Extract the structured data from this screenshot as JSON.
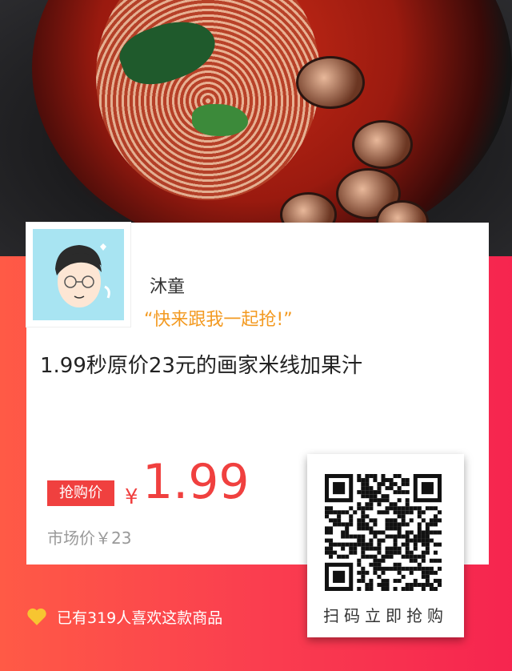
{
  "user": {
    "name": "沐童",
    "slogan": "“快来跟我一起抢!”"
  },
  "product": {
    "title": "1.99秒原价23元的画家米线加果汁",
    "price_tag": "抢购价",
    "currency": "¥",
    "price": "1.99",
    "market_price": "市场价￥23"
  },
  "qr": {
    "caption": "扫码立即抢购"
  },
  "likes": {
    "text": "已有319人喜欢这款商品"
  },
  "colors": {
    "accent": "#f0403f",
    "slogan": "#f39a21",
    "heart": "#f7c531"
  },
  "icons": [
    "heart-icon",
    "qr-code-icon",
    "avatar-illustration"
  ]
}
